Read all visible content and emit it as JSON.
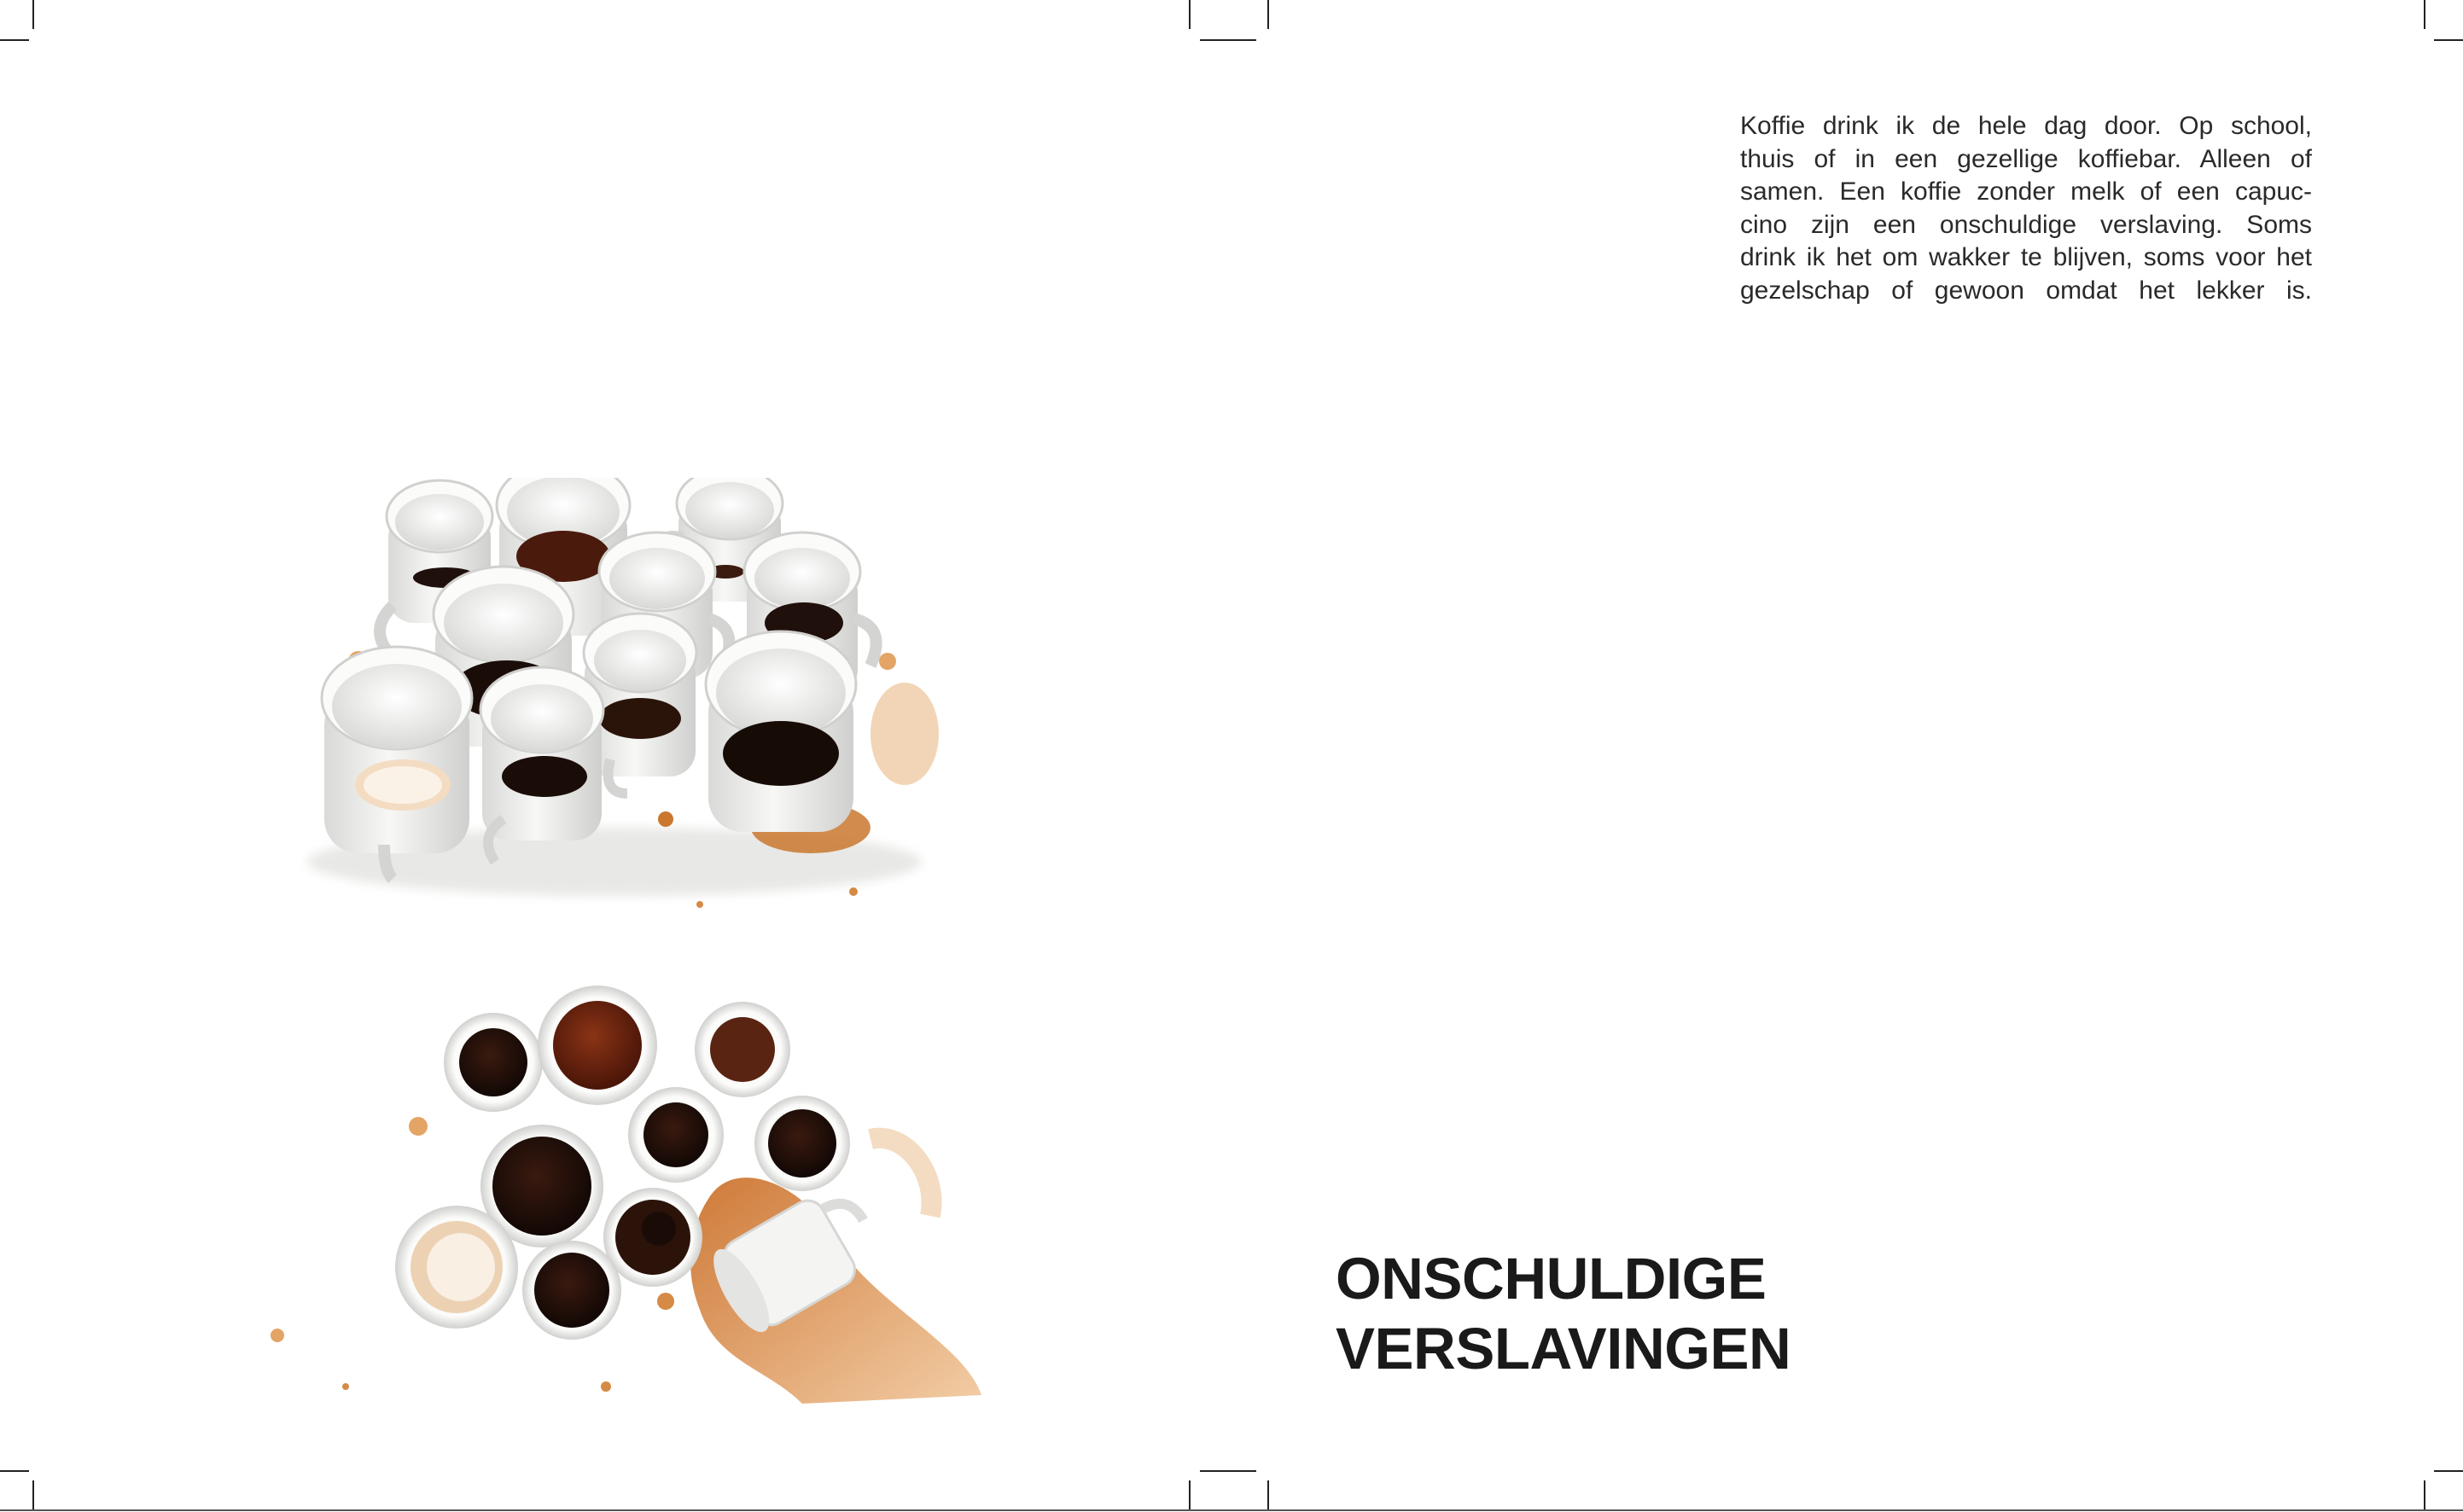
{
  "body_text_lines": [
    "Koffie drink ik de hele dag door. Op school,",
    "thuis of in een gezellige koffiebar. Alleen of",
    "samen. Een koffie zonder melk of een capuc-",
    "cino zijn een onschuldige verslaving. Soms",
    "drink ik het om wakker te blijven, soms voor het",
    "gezelschap of gewoon omdat het lekker is."
  ],
  "headline_lines": [
    "ONSCHULDIGE",
    "VERSLAVINGEN"
  ],
  "colors": {
    "coffee_dark": "#1f100b",
    "coffee_brown": "#4a1a0d",
    "tea_red": "#6b2210",
    "spill_orange": "#c9782e",
    "cup_white": "#f1f1ef",
    "text": "#2a2a2a"
  }
}
